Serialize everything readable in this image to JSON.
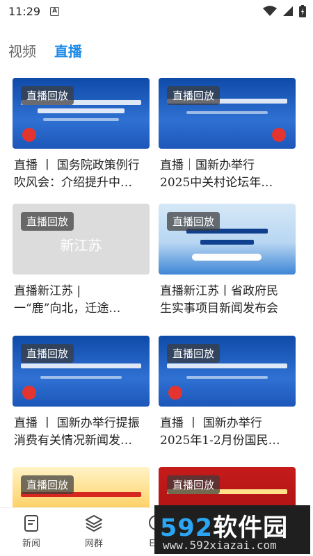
{
  "status_bar": {
    "time": "11:29",
    "notification_icon": "A"
  },
  "tabs": [
    {
      "label": "视频",
      "active": false
    },
    {
      "label": "直播",
      "active": true
    }
  ],
  "cards": [
    {
      "badge": "直播回放",
      "title_line1": "直播 丨 国务院政策例行",
      "title_line2": "吹风会：介绍提升中…",
      "thumb": "blue"
    },
    {
      "badge": "直播回放",
      "title_line1": "直播｜国新办举行",
      "title_line2": "2025中关村论坛年…",
      "thumb": "blue"
    },
    {
      "badge": "直播回放",
      "title_line1": "直播新江苏 |",
      "title_line2": "一“鹿”向北，迁途…",
      "thumb": "gray",
      "thumb_text": "新江苏"
    },
    {
      "badge": "直播回放",
      "title_line1": "直播新江苏丨省政府民",
      "title_line2": "生实事项目新闻发布会",
      "thumb": "light"
    },
    {
      "badge": "直播回放",
      "title_line1": "直播 丨 国新办举行提振",
      "title_line2": "消费有关情况新闻发…",
      "thumb": "blue"
    },
    {
      "badge": "直播回放",
      "title_line1": "直播 丨 国新办举行",
      "title_line2": "2025年1-2月份国民…",
      "thumb": "blue"
    },
    {
      "badge": "直播回放",
      "title_line1": "",
      "title_line2": "",
      "thumb": "festive"
    },
    {
      "badge": "直播回放",
      "title_line1": "",
      "title_line2": "",
      "thumb": "red"
    }
  ],
  "bottom_nav": [
    {
      "label": "新闻",
      "icon": "news-doc-icon"
    },
    {
      "label": "网群",
      "icon": "layers-icon"
    },
    {
      "label": "E起",
      "icon": "chat-icon"
    }
  ],
  "watermark": {
    "num": "592",
    "cn": "软件园",
    "url": "www.592xiazai.com"
  },
  "colors": {
    "accent": "#1d8be8",
    "thumb_blue": "#1c56b8"
  }
}
